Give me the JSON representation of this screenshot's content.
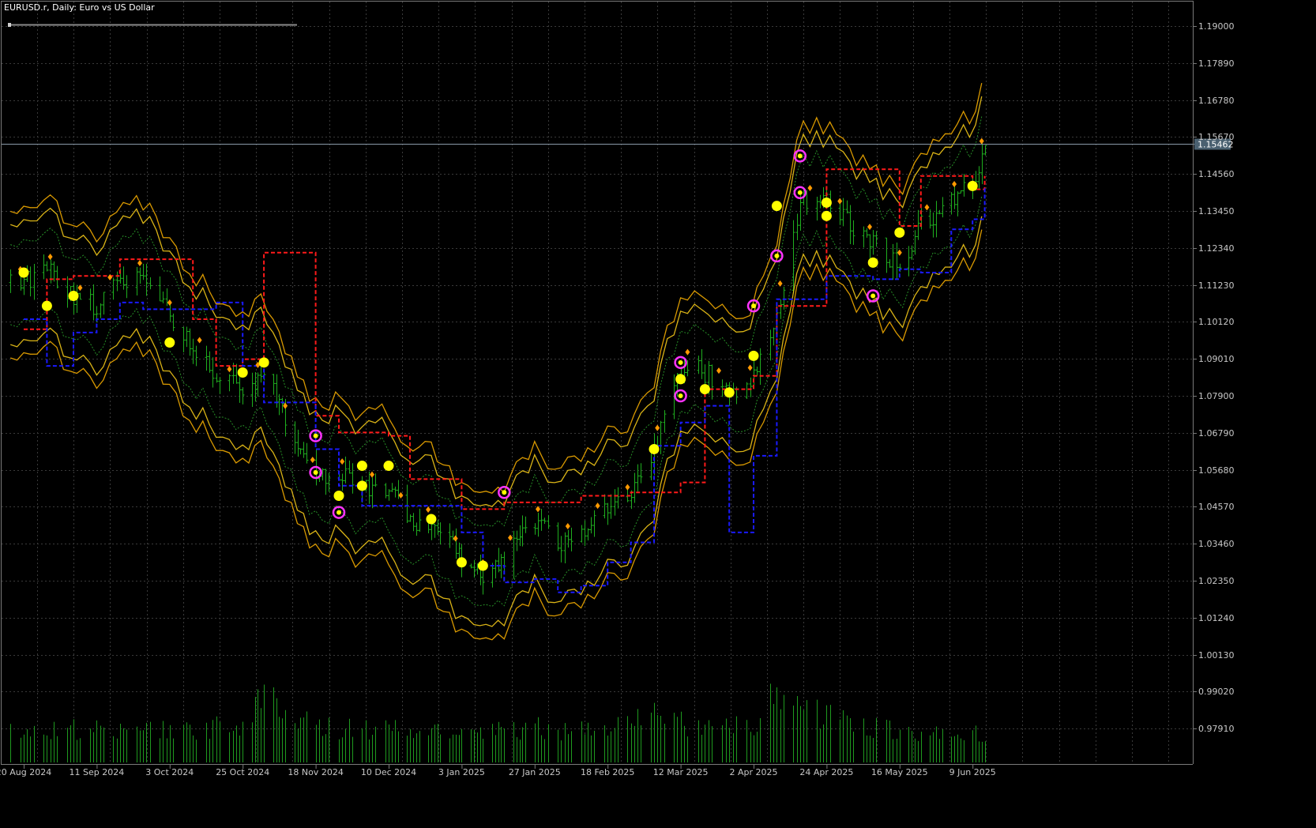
{
  "window": {
    "title": "EURUSD.r, Daily:  Euro vs US Dollar"
  },
  "colors": {
    "background": "#000000",
    "grid": "#3a3a3a",
    "axis_text": "#c8c8c8",
    "bars": "#1fae1f",
    "volume": "#1f9a1f",
    "upper_line": "#ff1a1a",
    "lower_line": "#1a1aff",
    "band_outer": "#ffb400",
    "band_inner": "#ffd21a",
    "band_mid": "#2ea82e",
    "band_center": "#b02cb0",
    "signal_dot": "#ffff00",
    "signal_ring": "#ff33ff",
    "diamond_marker": "#ff9900",
    "current_price_line": "#8a9aa8",
    "current_price_tag": "#4a6070"
  },
  "chart_data": {
    "type": "bar",
    "title": "EURUSD.r, Daily:  Euro vs US Dollar",
    "symbol": "EURUSD.r",
    "timeframe": "Daily",
    "description": "Euro vs US Dollar",
    "grid": true,
    "ylim": [
      1.0,
      1.195
    ],
    "y_ticks": [
      "1.19000",
      "1.17890",
      "1.16780",
      "1.15670",
      "1.14560",
      "1.13450",
      "1.12340",
      "1.11230",
      "1.10120",
      "1.09010",
      "1.07900",
      "1.06790",
      "1.05680",
      "1.04570",
      "1.03460",
      "1.02350",
      "1.01240",
      "1.00130",
      "0.99020",
      "0.97910"
    ],
    "x_ticks": [
      "20 Aug 2024",
      "11 Sep 2024",
      "3 Oct 2024",
      "25 Oct 2024",
      "18 Nov 2024",
      "10 Dec 2024",
      "3 Jan 2025",
      "27 Jan 2025",
      "18 Feb 2025",
      "12 Mar 2025",
      "2 Apr 2025",
      "24 Apr 2025",
      "16 May 2025",
      "9 Jun 2025"
    ],
    "current_price": "1.15462",
    "close_series": [
      {
        "date": "20 Aug 2024",
        "close": 1.113
      },
      {
        "date": "27 Aug 2024",
        "close": 1.118
      },
      {
        "date": "4 Sep 2024",
        "close": 1.108
      },
      {
        "date": "11 Sep 2024",
        "close": 1.106
      },
      {
        "date": "18 Sep 2024",
        "close": 1.114
      },
      {
        "date": "25 Sep 2024",
        "close": 1.115
      },
      {
        "date": "3 Oct 2024",
        "close": 1.103
      },
      {
        "date": "10 Oct 2024",
        "close": 1.094
      },
      {
        "date": "17 Oct 2024",
        "close": 1.086
      },
      {
        "date": "25 Oct 2024",
        "close": 1.08
      },
      {
        "date": "1 Nov 2024",
        "close": 1.086
      },
      {
        "date": "8 Nov 2024",
        "close": 1.072
      },
      {
        "date": "18 Nov 2024",
        "close": 1.054
      },
      {
        "date": "25 Nov 2024",
        "close": 1.056
      },
      {
        "date": "2 Dec 2024",
        "close": 1.051
      },
      {
        "date": "10 Dec 2024",
        "close": 1.052
      },
      {
        "date": "17 Dec 2024",
        "close": 1.04
      },
      {
        "date": "24 Dec 2024",
        "close": 1.041
      },
      {
        "date": "3 Jan 2025",
        "close": 1.03
      },
      {
        "date": "10 Jan 2025",
        "close": 1.025
      },
      {
        "date": "17 Jan 2025",
        "close": 1.03
      },
      {
        "date": "27 Jan 2025",
        "close": 1.042
      },
      {
        "date": "3 Feb 2025",
        "close": 1.035
      },
      {
        "date": "10 Feb 2025",
        "close": 1.037
      },
      {
        "date": "18 Feb 2025",
        "close": 1.045
      },
      {
        "date": "25 Feb 2025",
        "close": 1.048
      },
      {
        "date": "4 Mar 2025",
        "close": 1.062
      },
      {
        "date": "12 Mar 2025",
        "close": 1.089
      },
      {
        "date": "19 Mar 2025",
        "close": 1.086
      },
      {
        "date": "26 Mar 2025",
        "close": 1.08
      },
      {
        "date": "2 Apr 2025",
        "close": 1.084
      },
      {
        "date": "9 Apr 2025",
        "close": 1.104
      },
      {
        "date": "16 Apr 2025",
        "close": 1.137
      },
      {
        "date": "24 Apr 2025",
        "close": 1.138
      },
      {
        "date": "1 May 2025",
        "close": 1.13
      },
      {
        "date": "8 May 2025",
        "close": 1.125
      },
      {
        "date": "16 May 2025",
        "close": 1.118
      },
      {
        "date": "23 May 2025",
        "close": 1.13
      },
      {
        "date": "2 Jun 2025",
        "close": 1.138
      },
      {
        "date": "9 Jun 2025",
        "close": 1.142
      },
      {
        "date": "13 Jun 2025",
        "close": 1.1546
      }
    ],
    "upper_channel": [
      {
        "date": "20 Aug 2024",
        "value": 1.099
      },
      {
        "date": "27 Aug 2024",
        "value": 1.114
      },
      {
        "date": "4 Sep 2024",
        "value": 1.115
      },
      {
        "date": "18 Sep 2024",
        "value": 1.12
      },
      {
        "date": "3 Oct 2024",
        "value": 1.12
      },
      {
        "date": "10 Oct 2024",
        "value": 1.102
      },
      {
        "date": "17 Oct 2024",
        "value": 1.088
      },
      {
        "date": "25 Oct 2024",
        "value": 1.09
      },
      {
        "date": "1 Nov 2024",
        "value": 1.122
      },
      {
        "date": "8 Nov 2024",
        "value": 1.122
      },
      {
        "date": "18 Nov 2024",
        "value": 1.073
      },
      {
        "date": "25 Nov 2024",
        "value": 1.068
      },
      {
        "date": "10 Dec 2024",
        "value": 1.067
      },
      {
        "date": "17 Dec 2024",
        "value": 1.054
      },
      {
        "date": "3 Jan 2025",
        "value": 1.045
      },
      {
        "date": "17 Jan 2025",
        "value": 1.047
      },
      {
        "date": "27 Jan 2025",
        "value": 1.047
      },
      {
        "date": "10 Feb 2025",
        "value": 1.049
      },
      {
        "date": "25 Feb 2025",
        "value": 1.05
      },
      {
        "date": "12 Mar 2025",
        "value": 1.053
      },
      {
        "date": "19 Mar 2025",
        "value": 1.081
      },
      {
        "date": "2 Apr 2025",
        "value": 1.085
      },
      {
        "date": "9 Apr 2025",
        "value": 1.106
      },
      {
        "date": "24 Apr 2025",
        "value": 1.147
      },
      {
        "date": "8 May 2025",
        "value": 1.147
      },
      {
        "date": "16 May 2025",
        "value": 1.13
      },
      {
        "date": "23 May 2025",
        "value": 1.145
      },
      {
        "date": "2 Jun 2025",
        "value": 1.145
      },
      {
        "date": "9 Jun 2025",
        "value": 1.141
      },
      {
        "date": "13 Jun 2025",
        "value": 1.145
      }
    ],
    "lower_channel": [
      {
        "date": "20 Aug 2024",
        "value": 1.102
      },
      {
        "date": "27 Aug 2024",
        "value": 1.088
      },
      {
        "date": "4 Sep 2024",
        "value": 1.098
      },
      {
        "date": "11 Sep 2024",
        "value": 1.102
      },
      {
        "date": "18 Sep 2024",
        "value": 1.107
      },
      {
        "date": "25 Sep 2024",
        "value": 1.105
      },
      {
        "date": "10 Oct 2024",
        "value": 1.105
      },
      {
        "date": "17 Oct 2024",
        "value": 1.107
      },
      {
        "date": "25 Oct 2024",
        "value": 1.088
      },
      {
        "date": "1 Nov 2024",
        "value": 1.077
      },
      {
        "date": "8 Nov 2024",
        "value": 1.077
      },
      {
        "date": "18 Nov 2024",
        "value": 1.063
      },
      {
        "date": "25 Nov 2024",
        "value": 1.052
      },
      {
        "date": "2 Dec 2024",
        "value": 1.046
      },
      {
        "date": "17 Dec 2024",
        "value": 1.046
      },
      {
        "date": "3 Jan 2025",
        "value": 1.038
      },
      {
        "date": "10 Jan 2025",
        "value": 1.028
      },
      {
        "date": "17 Jan 2025",
        "value": 1.023
      },
      {
        "date": "27 Jan 2025",
        "value": 1.024
      },
      {
        "date": "3 Feb 2025",
        "value": 1.02
      },
      {
        "date": "10 Feb 2025",
        "value": 1.022
      },
      {
        "date": "18 Feb 2025",
        "value": 1.029
      },
      {
        "date": "25 Feb 2025",
        "value": 1.035
      },
      {
        "date": "4 Mar 2025",
        "value": 1.064
      },
      {
        "date": "12 Mar 2025",
        "value": 1.071
      },
      {
        "date": "19 Mar 2025",
        "value": 1.076
      },
      {
        "date": "26 Mar 2025",
        "value": 1.038
      },
      {
        "date": "2 Apr 2025",
        "value": 1.061
      },
      {
        "date": "9 Apr 2025",
        "value": 1.108
      },
      {
        "date": "16 Apr 2025",
        "value": 1.108
      },
      {
        "date": "24 Apr 2025",
        "value": 1.115
      },
      {
        "date": "8 May 2025",
        "value": 1.114
      },
      {
        "date": "16 May 2025",
        "value": 1.117
      },
      {
        "date": "23 May 2025",
        "value": 1.116
      },
      {
        "date": "2 Jun 2025",
        "value": 1.129
      },
      {
        "date": "9 Jun 2025",
        "value": 1.132
      },
      {
        "date": "13 Jun 2025",
        "value": 1.142
      }
    ],
    "signals": [
      {
        "date": "20 Aug 2024",
        "price": 1.116,
        "type": "dot"
      },
      {
        "date": "27 Aug 2024",
        "price": 1.106,
        "type": "dot"
      },
      {
        "date": "4 Sep 2024",
        "price": 1.109,
        "type": "dot"
      },
      {
        "date": "3 Oct 2024",
        "price": 1.095,
        "type": "dot"
      },
      {
        "date": "25 Oct 2024",
        "price": 1.086,
        "type": "dot"
      },
      {
        "date": "1 Nov 2024",
        "price": 1.089,
        "type": "dot"
      },
      {
        "date": "18 Nov 2024",
        "price": 1.067,
        "type": "ring"
      },
      {
        "date": "18 Nov 2024",
        "price": 1.056,
        "type": "ring"
      },
      {
        "date": "25 Nov 2024",
        "price": 1.044,
        "type": "ring"
      },
      {
        "date": "25 Nov 2024",
        "price": 1.049,
        "type": "dot"
      },
      {
        "date": "2 Dec 2024",
        "price": 1.058,
        "type": "dot"
      },
      {
        "date": "2 Dec 2024",
        "price": 1.052,
        "type": "dot"
      },
      {
        "date": "10 Dec 2024",
        "price": 1.058,
        "type": "dot"
      },
      {
        "date": "24 Dec 2024",
        "price": 1.042,
        "type": "dot"
      },
      {
        "date": "3 Jan 2025",
        "price": 1.029,
        "type": "dot"
      },
      {
        "date": "10 Jan 2025",
        "price": 1.028,
        "type": "dot"
      },
      {
        "date": "17 Jan 2025",
        "price": 1.05,
        "type": "ring"
      },
      {
        "date": "4 Mar 2025",
        "price": 1.063,
        "type": "dot"
      },
      {
        "date": "12 Mar 2025",
        "price": 1.079,
        "type": "ring"
      },
      {
        "date": "12 Mar 2025",
        "price": 1.084,
        "type": "dot"
      },
      {
        "date": "12 Mar 2025",
        "price": 1.089,
        "type": "ring"
      },
      {
        "date": "19 Mar 2025",
        "price": 1.081,
        "type": "dot"
      },
      {
        "date": "26 Mar 2025",
        "price": 1.08,
        "type": "dot"
      },
      {
        "date": "2 Apr 2025",
        "price": 1.091,
        "type": "dot"
      },
      {
        "date": "2 Apr 2025",
        "price": 1.106,
        "type": "ring"
      },
      {
        "date": "9 Apr 2025",
        "price": 1.121,
        "type": "ring"
      },
      {
        "date": "9 Apr 2025",
        "price": 1.136,
        "type": "dot"
      },
      {
        "date": "16 Apr 2025",
        "price": 1.14,
        "type": "ring"
      },
      {
        "date": "16 Apr 2025",
        "price": 1.151,
        "type": "ring"
      },
      {
        "date": "24 Apr 2025",
        "price": 1.133,
        "type": "dot"
      },
      {
        "date": "24 Apr 2025",
        "price": 1.137,
        "type": "dot"
      },
      {
        "date": "8 May 2025",
        "price": 1.109,
        "type": "ring"
      },
      {
        "date": "8 May 2025",
        "price": 1.119,
        "type": "dot"
      },
      {
        "date": "16 May 2025",
        "price": 1.128,
        "type": "dot"
      },
      {
        "date": "9 Jun 2025",
        "price": 1.142,
        "type": "dot"
      }
    ],
    "volume": [
      {
        "date": "20 Aug 2024",
        "value": 42
      },
      {
        "date": "11 Sep 2024",
        "value": 48
      },
      {
        "date": "3 Oct 2024",
        "value": 44
      },
      {
        "date": "25 Oct 2024",
        "value": 52
      },
      {
        "date": "1 Nov 2024",
        "value": 90
      },
      {
        "date": "18 Nov 2024",
        "value": 50
      },
      {
        "date": "10 Dec 2024",
        "value": 46
      },
      {
        "date": "3 Jan 2025",
        "value": 40
      },
      {
        "date": "27 Jan 2025",
        "value": 48
      },
      {
        "date": "18 Feb 2025",
        "value": 42
      },
      {
        "date": "4 Mar 2025",
        "value": 70
      },
      {
        "date": "12 Mar 2025",
        "value": 55
      },
      {
        "date": "2 Apr 2025",
        "value": 48
      },
      {
        "date": "9 Apr 2025",
        "value": 100
      },
      {
        "date": "24 Apr 2025",
        "value": 62
      },
      {
        "date": "16 May 2025",
        "value": 45
      },
      {
        "date": "9 Jun 2025",
        "value": 42
      }
    ]
  }
}
